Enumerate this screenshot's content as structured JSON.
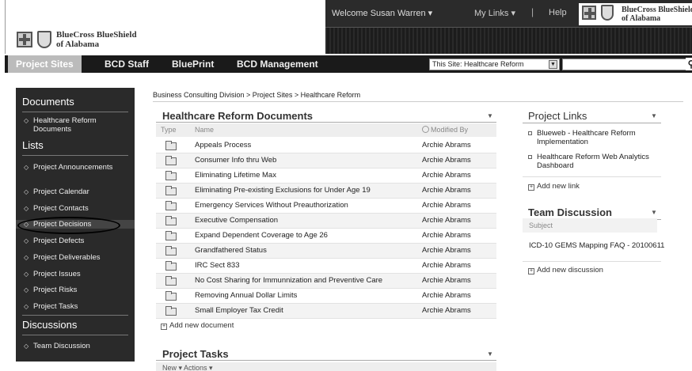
{
  "header": {
    "welcome": "Welcome Susan Warren",
    "my_links": "My Links",
    "separator": "|",
    "help": "Help",
    "logo_line1": "BlueCross BlueShield",
    "logo_line2": "of Alabama",
    "top_logo_line1": "BlueCross BlueShield",
    "top_logo_line2": "of Alabama"
  },
  "nav": {
    "items": [
      "Project Sites",
      "BCD Staff",
      "BluePrint",
      "BCD Management"
    ],
    "active": "Project Sites",
    "site_select": "This Site: Healthcare Reform",
    "search_placeholder": ""
  },
  "leftnav": {
    "documents_heading": "Documents",
    "documents_items": [
      "Healthcare Reform Documents"
    ],
    "lists_heading": "Lists",
    "list_items": [
      "Project Announcements",
      "Project Calendar",
      "Project Contacts",
      "Project Decisions",
      "Project Defects",
      "Project Deliverables",
      "Project Issues",
      "Project Risks",
      "Project Tasks"
    ],
    "discussions_heading": "Discussions",
    "discussion_items": [
      "Team Discussion"
    ],
    "highlighted": "Project Decisions"
  },
  "breadcrumb": "Business Consulting Division > Project Sites > Healthcare Reform",
  "documents": {
    "title": "Healthcare Reform Documents",
    "col_type": "Type",
    "col_name": "Name",
    "col_modified": "Modified By",
    "rows": [
      {
        "name": "Appeals Process",
        "modified_by": "Archie Abrams"
      },
      {
        "name": "Consumer Info thru Web",
        "modified_by": "Archie Abrams"
      },
      {
        "name": "Eliminating Lifetime Max",
        "modified_by": "Archie Abrams"
      },
      {
        "name": "Eliminating Pre-existing Exclusions for Under Age 19",
        "modified_by": "Archie Abrams"
      },
      {
        "name": "Emergency Services Without Preauthorization",
        "modified_by": "Archie Abrams"
      },
      {
        "name": "Executive Compensation",
        "modified_by": "Archie Abrams"
      },
      {
        "name": "Expand Dependent Coverage to Age 26",
        "modified_by": "Archie Abrams"
      },
      {
        "name": "Grandfathered Status",
        "modified_by": "Archie Abrams"
      },
      {
        "name": "IRC Sect 833",
        "modified_by": "Archie Abrams"
      },
      {
        "name": "No Cost Sharing for Immunnization and Preventive Care",
        "modified_by": "Archie Abrams"
      },
      {
        "name": "Removing Annual Dollar Limits",
        "modified_by": "Archie Abrams"
      },
      {
        "name": "Small Employer Tax Credit",
        "modified_by": "Archie Abrams"
      }
    ],
    "add_new": "Add new document"
  },
  "tasks": {
    "title": "Project Tasks",
    "toolbar": "New  ▾    Actions ▾"
  },
  "project_links": {
    "title": "Project Links",
    "items": [
      "Blueweb - Healthcare Reform Implementation",
      "Healthcare Reform Web Analytics Dashboard"
    ],
    "add_new": "Add new link"
  },
  "team_discussion": {
    "title": "Team Discussion",
    "col_subject": "Subject",
    "items": [
      "ICD-10 GEMS Mapping FAQ - 20100611"
    ],
    "add_new": "Add new discussion"
  }
}
